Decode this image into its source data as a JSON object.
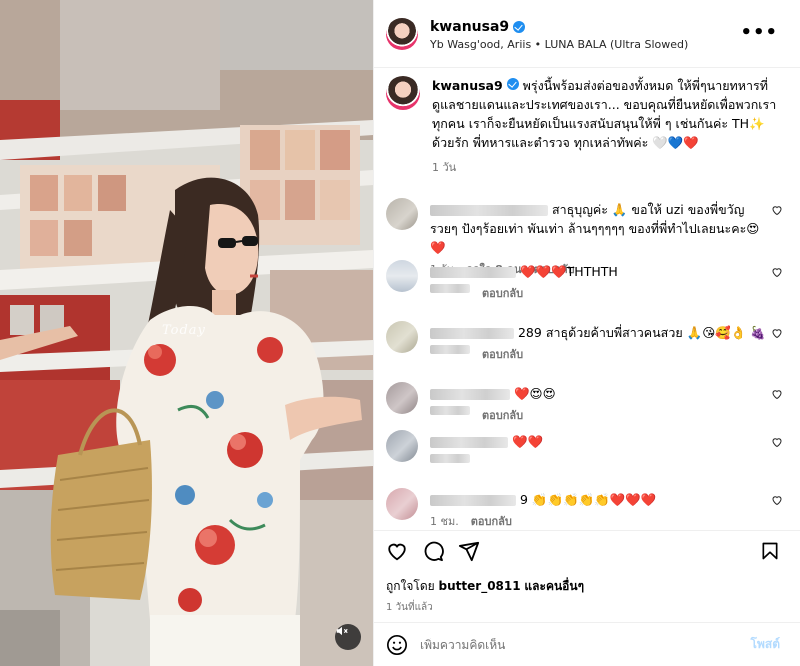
{
  "post": {
    "username": "kwanusa9",
    "audio": "Yb Wasg'ood, Ariis • LUNA BALA (Ultra Slowed)",
    "watermark": "Today",
    "caption": {
      "emoji_suffix": "🤍💙❤️",
      "text": "พรุ่งนี้พร้อมส่งต่อของทั้งหมด ให้พี่ๆนายทหารที่ดูแลชายแดนและประเทศของเรา... ขอบคุณที่ยืนหยัดเพื่อพวกเราทุกคน เราก็จะยืนหยัดเป็นแรงสนับสนุนให้พี่ ๆ เช่นกันค่ะ TH✨ ด้วยรัก พี่ทหารและตำรวจ ทุกเหล่าทัพค่ะ 🤍💙❤️",
      "time": "1 วัน"
    },
    "comments": [
      {
        "text": "สาธุบุญค่ะ 🙏 ขอให้ uzi ของพี่ขวัญรวยๆ ปังๆร้อยเท่า พันเท่า ล้านๆๆๆๆๆ ของที่พี่ทำไปเลยนะคะ😍❤️",
        "time": "1 วัน",
        "likes": "ถูกใจ 8 คน",
        "reply": "ตอบกลับ"
      },
      {
        "text": "❤️❤️❤️THTHTH",
        "time": "",
        "likes": "",
        "reply": "ตอบกลับ"
      },
      {
        "text": "289 สาธุด้วยค้าบพี่สาวคนสวย 🙏😘🥰👌 🍇",
        "time": "",
        "likes": "",
        "reply": "ตอบกลับ"
      },
      {
        "text": "❤️😍😍",
        "time": "",
        "likes": "",
        "reply": "ตอบกลับ"
      },
      {
        "text": "❤️❤️",
        "time": "",
        "likes": "",
        "reply": ""
      },
      {
        "text": "9 👏👏👏👏👏❤️❤️❤️",
        "time": "1 ชม.",
        "likes": "",
        "reply": "ตอบกลับ"
      }
    ]
  },
  "actions": {
    "liked_by_prefix": "ถูกใจโดย",
    "liked_by_user": "butter_0811",
    "liked_by_suffix": "และคนอื่นๆ",
    "posted_ago": "1 วันที่แล้ว"
  },
  "composer": {
    "placeholder": "เพิ่มความคิดเห็น",
    "post_label": "โพสต์"
  },
  "colors": {
    "verified": "#1f8ef0",
    "post_button_disabled": "#b3dbff",
    "like_red": "#ed4956"
  }
}
